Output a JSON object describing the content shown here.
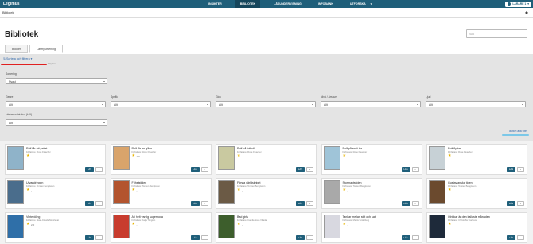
{
  "app": {
    "logo": "Legimus"
  },
  "nav": [
    {
      "label": "INSIKTER",
      "active": false,
      "dropdown": false
    },
    {
      "label": "BIBLIOTEK",
      "active": true,
      "dropdown": false
    },
    {
      "label": "LÄSUNDERVISNING",
      "active": false,
      "dropdown": false
    },
    {
      "label": "INFOBANK",
      "active": false,
      "dropdown": false
    },
    {
      "label": "UTFORSKA",
      "active": false,
      "dropdown": true
    }
  ],
  "user": {
    "label": "LÄRARE 1"
  },
  "breadcrumb": "Bibliotek",
  "page": {
    "title": "Bibliotek",
    "search_placeholder": "Sök"
  },
  "tabs": [
    {
      "label": "Böcker",
      "active": false
    },
    {
      "label": "Läsfrystræning",
      "active": true
    }
  ],
  "filters": {
    "toggle_label": "Sortera och filtrera",
    "hint": "Dölj filter",
    "sort": {
      "label": "Sortering",
      "value": "Nyast"
    },
    "row": [
      {
        "label": "Genre",
        "value": "Allt"
      },
      {
        "label": "Språk",
        "value": "Allt"
      },
      {
        "label": "Gick",
        "value": "Allt"
      },
      {
        "label": "Nivå / Årskurs",
        "value": "Allt"
      },
      {
        "label": "Ljud",
        "value": "Allt"
      }
    ],
    "lix": {
      "label": "Läsbarhetsindex (LIX)",
      "value": "Allt"
    },
    "clear_label": "Ta bort alla filter"
  },
  "books": [
    {
      "title": "Rolf får ett paket",
      "author": "Författare: Rose Fleacher",
      "rating": "-",
      "color": "#8fb3c9"
    },
    {
      "title": "Rolf får en gåva",
      "author": "Författare: Rose Fleacher",
      "rating": "1.0",
      "color": "#d9a46b"
    },
    {
      "title": "Rolf på fotboll",
      "author": "Författare: Rose Fleacher",
      "rating": "-",
      "color": "#c9c9a0"
    },
    {
      "title": "Rolf på en ö tur",
      "author": "Författare: Rose Fleacher",
      "rating": "-",
      "color": "#9fc4d8"
    },
    {
      "title": "Rolf flyttar",
      "author": "Författare: Rose Fleacher",
      "rating": "-",
      "color": "#c7d1d6"
    },
    {
      "title": "Utvandringen",
      "author": "Författare: Torsten Bengtsson",
      "rating": "-",
      "color": "#4a6d8c"
    },
    {
      "title": "Frihetstiden",
      "author": "Författare: Torsten Bengtsson",
      "rating": "-",
      "color": "#b3542e"
    },
    {
      "title": "Första världskriget",
      "author": "Författare: Torsten Bengtsson",
      "rating": "-",
      "color": "#6b5a45"
    },
    {
      "title": "Stormaktstiden",
      "author": "Författare: Torsten Bengtsson",
      "rating": "-",
      "color": "#a9a9a9"
    },
    {
      "title": "Gustavianska tiden",
      "author": "Författare: Torsten Bengtsson",
      "rating": "-",
      "color": "#6b4a2e"
    },
    {
      "title": "Vinterdöng",
      "author": "Författare: Jean-Claude Mourlevat",
      "rating": "2.0",
      "color": "#2f6fa8"
    },
    {
      "title": "Ari helt vanlig supernova",
      "author": "Författare: Katja Timgren",
      "rating": "-",
      "color": "#c83c2e"
    },
    {
      "title": "Bad girls",
      "author": "Författare: Camila Sosa Villada",
      "rating": "-",
      "color": "#3d5e2c"
    },
    {
      "title": "Tankar mellan stilt och satt",
      "author": "Författare: Mattis Söderberg",
      "rating": "-",
      "color": "#d8d8e0"
    },
    {
      "title": "Olrickar är den kallaste månaden",
      "author": "Författare: Christoffer Carlsson",
      "rating": "-",
      "color": "#1e2a3a"
    }
  ],
  "card_buttons": {
    "primary": "LÄS",
    "more": "⌄"
  },
  "icons": {
    "star": "★",
    "user": "user-icon",
    "home": "home-icon"
  }
}
